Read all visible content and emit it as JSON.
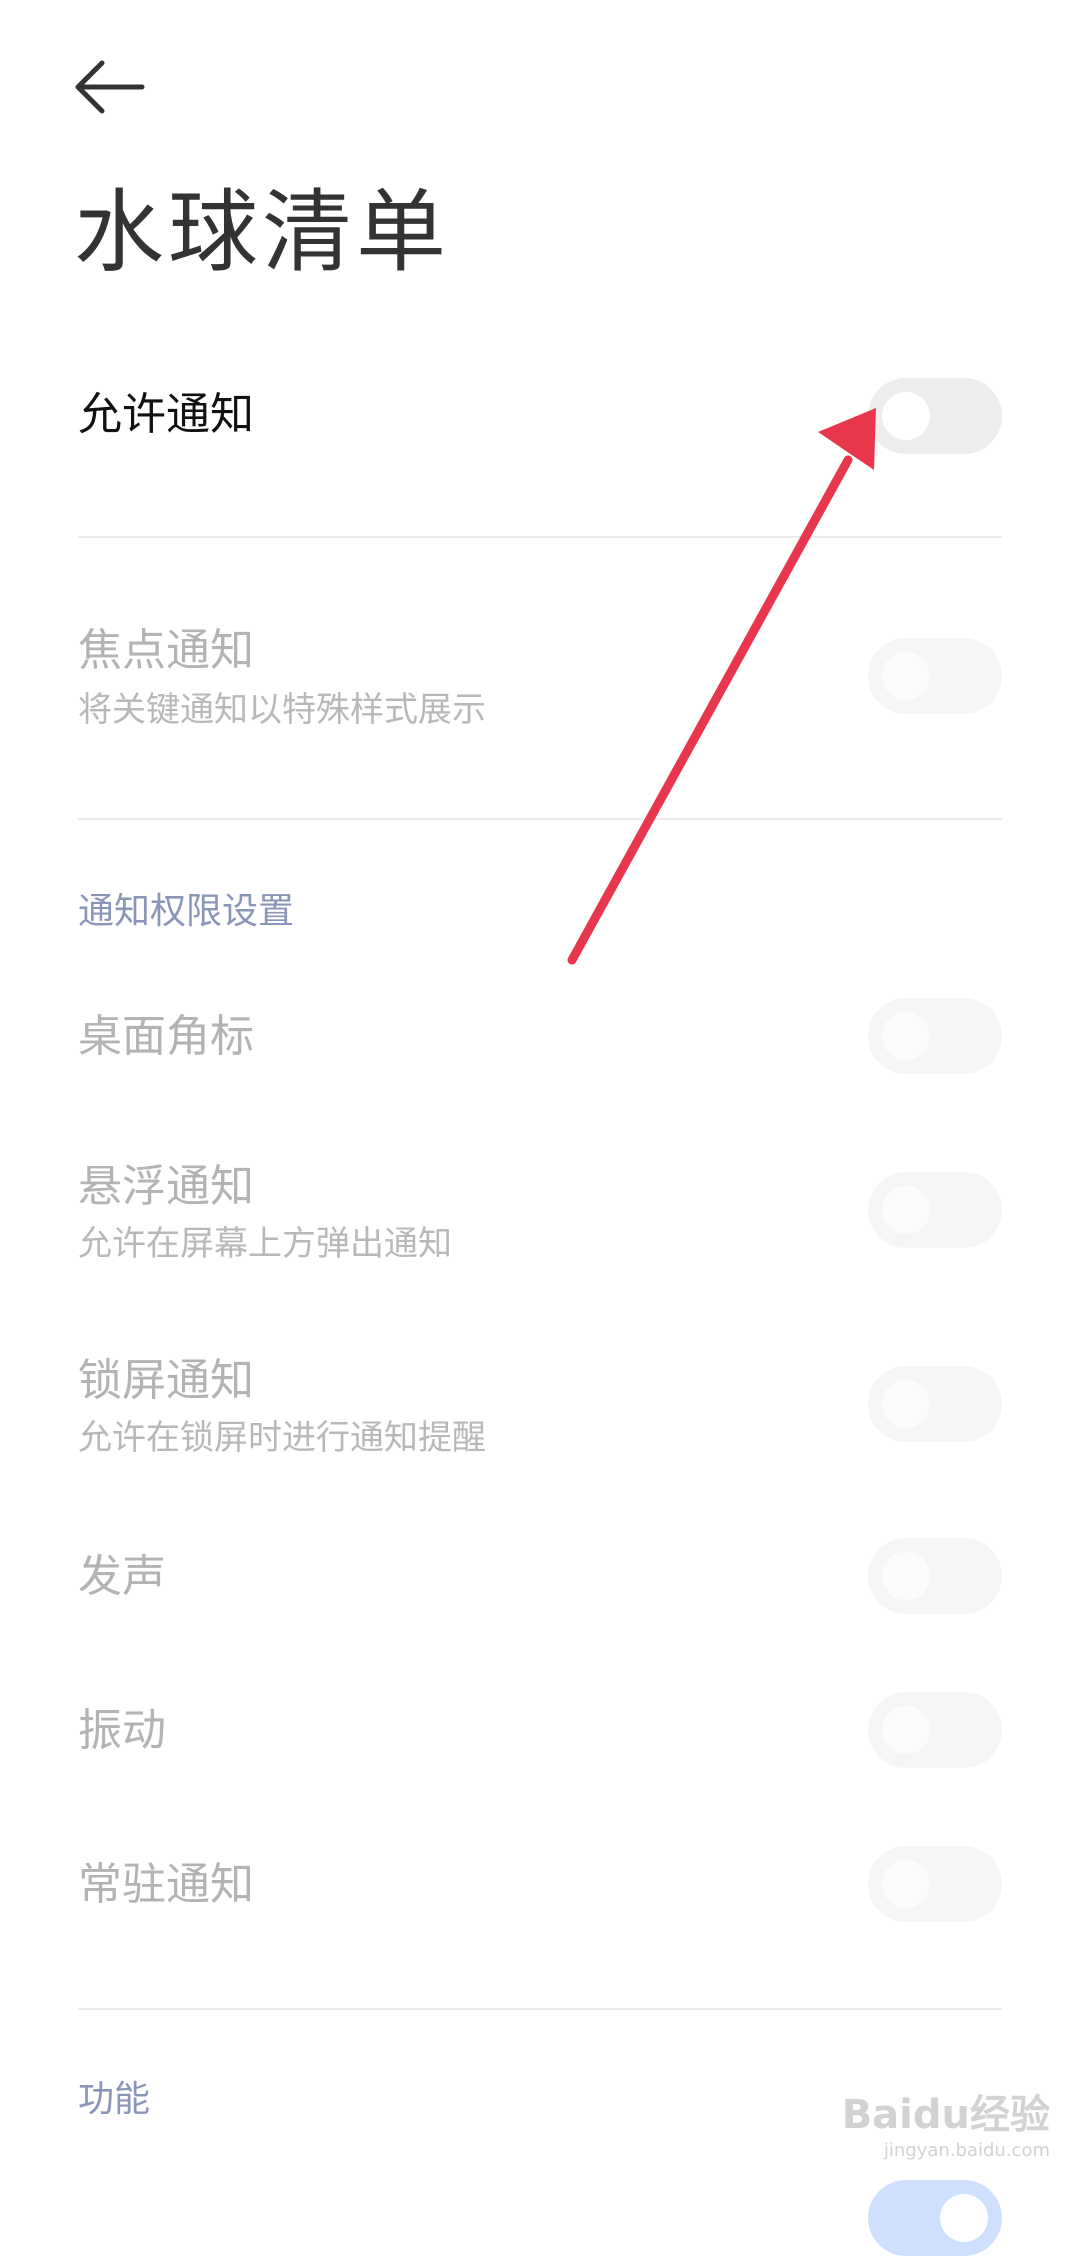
{
  "page": {
    "title": "水球清单"
  },
  "allow_notifications": {
    "label": "允许通知",
    "enabled": false
  },
  "focus_notifications": {
    "label": "焦点通知",
    "description": "将关键通知以特殊样式展示",
    "enabled": false
  },
  "sections": {
    "permissions": "通知权限设置",
    "features": "功能"
  },
  "permission_items": [
    {
      "label": "桌面角标",
      "enabled": false
    },
    {
      "label": "悬浮通知",
      "description": "允许在屏幕上方弹出通知",
      "enabled": false
    },
    {
      "label": "锁屏通知",
      "description": "允许在锁屏时进行通知提醒",
      "enabled": false
    },
    {
      "label": "发声",
      "enabled": false
    },
    {
      "label": "振动",
      "enabled": false
    },
    {
      "label": "常驻通知",
      "enabled": false
    }
  ],
  "watermark": {
    "text": "Baidu经验",
    "sub": "jingyan.baidu.com"
  },
  "colors": {
    "annotation_arrow": "#e8374c",
    "section_header": "#8a96b8"
  },
  "icons": {
    "back": "back-arrow-icon"
  }
}
